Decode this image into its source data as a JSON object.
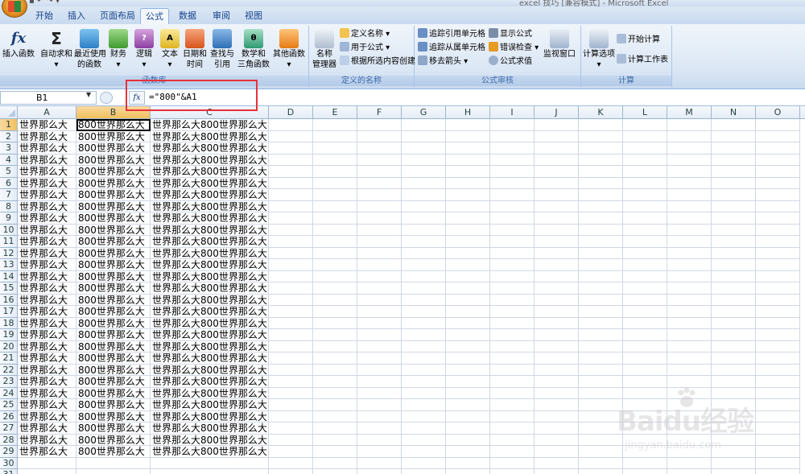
{
  "window": {
    "title": "excel 技巧 [兼容模式] - Microsoft Excel"
  },
  "tabs": [
    {
      "label": "开始",
      "active": false
    },
    {
      "label": "插入",
      "active": false
    },
    {
      "label": "页面布局",
      "active": false
    },
    {
      "label": "公式",
      "active": true
    },
    {
      "label": "数据",
      "active": false
    },
    {
      "label": "审阅",
      "active": false
    },
    {
      "label": "视图",
      "active": false
    }
  ],
  "ribbon": {
    "function_library": {
      "label": "函数库",
      "insert_function": "插入函数",
      "autosum": "自动求和",
      "recently_used_1": "最近使用",
      "recently_used_2": "的函数",
      "financial": "财务",
      "logical": "逻辑",
      "text": "文本",
      "datetime_1": "日期和",
      "datetime_2": "时间",
      "lookup_1": "查找与",
      "lookup_2": "引用",
      "math_1": "数学和",
      "math_2": "三角函数",
      "more_functions": "其他函数"
    },
    "defined_names": {
      "label": "定义的名称",
      "name_manager_1": "名称",
      "name_manager_2": "管理器",
      "define_name": "定义名称",
      "use_in_formula": "用于公式",
      "create_from_selection": "根据所选内容创建"
    },
    "formula_auditing": {
      "label": "公式审核",
      "trace_precedents": "追踪引用单元格",
      "trace_dependents": "追踪从属单元格",
      "remove_arrows": "移去箭头",
      "show_formulas": "显示公式",
      "error_checking": "错误检查",
      "evaluate_formula": "公式求值",
      "watch_window": "监视窗口"
    },
    "calculation": {
      "label": "计算",
      "calc_options": "计算选项",
      "calc_now": "开始计算",
      "calc_sheet": "计算工作表"
    }
  },
  "formula_bar": {
    "name_box": "B1",
    "fx": "fx",
    "formula": "=\"800\"&A1"
  },
  "columns": [
    "A",
    "B",
    "C",
    "D",
    "E",
    "F",
    "G",
    "H",
    "I",
    "J",
    "K",
    "L",
    "M",
    "N",
    "O"
  ],
  "selected_column": "B",
  "active_cell": "B1",
  "rows": [
    {
      "n": "1",
      "a": "世界那么大",
      "b": "800世界那么大",
      "c": "世界那么大800世界那么大"
    },
    {
      "n": "2",
      "a": "世界那么大",
      "b": "800世界那么大",
      "c": "世界那么大800世界那么大"
    },
    {
      "n": "3",
      "a": "世界那么大",
      "b": "800世界那么大",
      "c": "世界那么大800世界那么大"
    },
    {
      "n": "4",
      "a": "世界那么大",
      "b": "800世界那么大",
      "c": "世界那么大800世界那么大"
    },
    {
      "n": "5",
      "a": "世界那么大",
      "b": "800世界那么大",
      "c": "世界那么大800世界那么大"
    },
    {
      "n": "6",
      "a": "世界那么大",
      "b": "800世界那么大",
      "c": "世界那么大800世界那么大"
    },
    {
      "n": "7",
      "a": "世界那么大",
      "b": "800世界那么大",
      "c": "世界那么大800世界那么大"
    },
    {
      "n": "8",
      "a": "世界那么大",
      "b": "800世界那么大",
      "c": "世界那么大800世界那么大"
    },
    {
      "n": "9",
      "a": "世界那么大",
      "b": "800世界那么大",
      "c": "世界那么大800世界那么大"
    },
    {
      "n": "10",
      "a": "世界那么大",
      "b": "800世界那么大",
      "c": "世界那么大800世界那么大"
    },
    {
      "n": "11",
      "a": "世界那么大",
      "b": "800世界那么大",
      "c": "世界那么大800世界那么大"
    },
    {
      "n": "12",
      "a": "世界那么大",
      "b": "800世界那么大",
      "c": "世界那么大800世界那么大"
    },
    {
      "n": "13",
      "a": "世界那么大",
      "b": "800世界那么大",
      "c": "世界那么大800世界那么大"
    },
    {
      "n": "14",
      "a": "世界那么大",
      "b": "800世界那么大",
      "c": "世界那么大800世界那么大"
    },
    {
      "n": "15",
      "a": "世界那么大",
      "b": "800世界那么大",
      "c": "世界那么大800世界那么大"
    },
    {
      "n": "16",
      "a": "世界那么大",
      "b": "800世界那么大",
      "c": "世界那么大800世界那么大"
    },
    {
      "n": "17",
      "a": "世界那么大",
      "b": "800世界那么大",
      "c": "世界那么大800世界那么大"
    },
    {
      "n": "18",
      "a": "世界那么大",
      "b": "800世界那么大",
      "c": "世界那么大800世界那么大"
    },
    {
      "n": "19",
      "a": "世界那么大",
      "b": "800世界那么大",
      "c": "世界那么大800世界那么大"
    },
    {
      "n": "20",
      "a": "世界那么大",
      "b": "800世界那么大",
      "c": "世界那么大800世界那么大"
    },
    {
      "n": "21",
      "a": "世界那么大",
      "b": "800世界那么大",
      "c": "世界那么大800世界那么大"
    },
    {
      "n": "22",
      "a": "世界那么大",
      "b": "800世界那么大",
      "c": "世界那么大800世界那么大"
    },
    {
      "n": "23",
      "a": "世界那么大",
      "b": "800世界那么大",
      "c": "世界那么大800世界那么大"
    },
    {
      "n": "24",
      "a": "世界那么大",
      "b": "800世界那么大",
      "c": "世界那么大800世界那么大"
    },
    {
      "n": "25",
      "a": "世界那么大",
      "b": "800世界那么大",
      "c": "世界那么大800世界那么大"
    },
    {
      "n": "26",
      "a": "世界那么大",
      "b": "800世界那么大",
      "c": "世界那么大800世界那么大"
    },
    {
      "n": "27",
      "a": "世界那么大",
      "b": "800世界那么大",
      "c": "世界那么大800世界那么大"
    },
    {
      "n": "28",
      "a": "世界那么大",
      "b": "800世界那么大",
      "c": "世界那么大800世界那么大"
    },
    {
      "n": "29",
      "a": "世界那么大",
      "b": "800世界那么大",
      "c": "世界那么大800世界那么大"
    },
    {
      "n": "30",
      "a": "",
      "b": "",
      "c": ""
    },
    {
      "n": "31",
      "a": "",
      "b": "",
      "c": ""
    }
  ],
  "watermark": {
    "logo": "Baidu经验",
    "url": "jingyan.baidu.com"
  },
  "colors": {
    "accent": "#15428b",
    "highlight_box": "#e8313a",
    "selected_header": "#f1c15f"
  }
}
